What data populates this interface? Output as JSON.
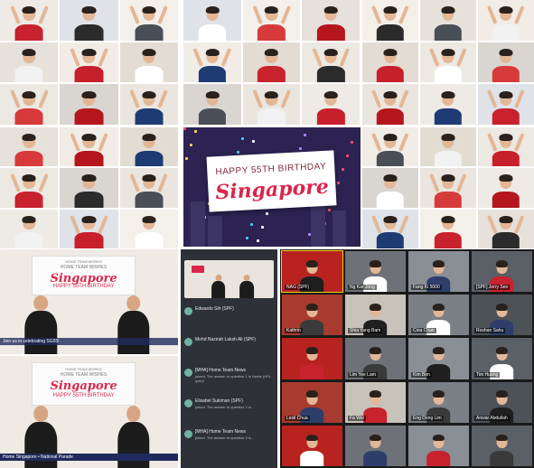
{
  "banner": {
    "happy": "HAPPY 55TH BIRTHDAY",
    "singapore": "Singapore"
  },
  "broadcast_top": {
    "screen_small": "HOME TEAM WORKS",
    "screen_line": "HOME TEAM WISHES",
    "screen_title": "Singapore",
    "screen_sub": "HAPPY 55TH BIRTHDAY",
    "caption": "Join us in celebrating SG55!"
  },
  "broadcast_bottom": {
    "screen_small": "HOME TEAM WORKS",
    "screen_line": "HOME TEAM WISHES",
    "screen_title": "Singapore",
    "screen_sub": "HAPPY 55TH BIRTHDAY",
    "lower_third": "Home Singapore • National Parade"
  },
  "chat": [
    {
      "name": "Edwardo Sih (SPF)",
      "msg": ""
    },
    {
      "name": "Mohd Nazirah Laksh Ali (SPF)",
      "msg": ""
    },
    {
      "name": "[MHA] Home Team News",
      "msg": "joined. The answer to question 1 is Horde (HPL quiz)!"
    },
    {
      "name": "Elisabel Sukiman (SPF)",
      "msg": "joined. The answer to question 2 is..."
    },
    {
      "name": "[MHA] Home Team News",
      "msg": "joined. The answer to question 3 is..."
    }
  ],
  "zoom_names": [
    "NAG (SPF)",
    "Ng Kar Jong",
    "Fang Ki 5000",
    "[SPF] Jerry Seo",
    "Kathrin",
    "Shia Yang Bam",
    "Cina Chan",
    "Roshan Sahu",
    "",
    "Lim Yee Lam",
    "Kim Ben",
    "Tim Huang",
    "Lesli Chua",
    "Fa Wei",
    "Eng Dong Lim",
    "Anwar Abdullah",
    "",
    "",
    "",
    ""
  ]
}
